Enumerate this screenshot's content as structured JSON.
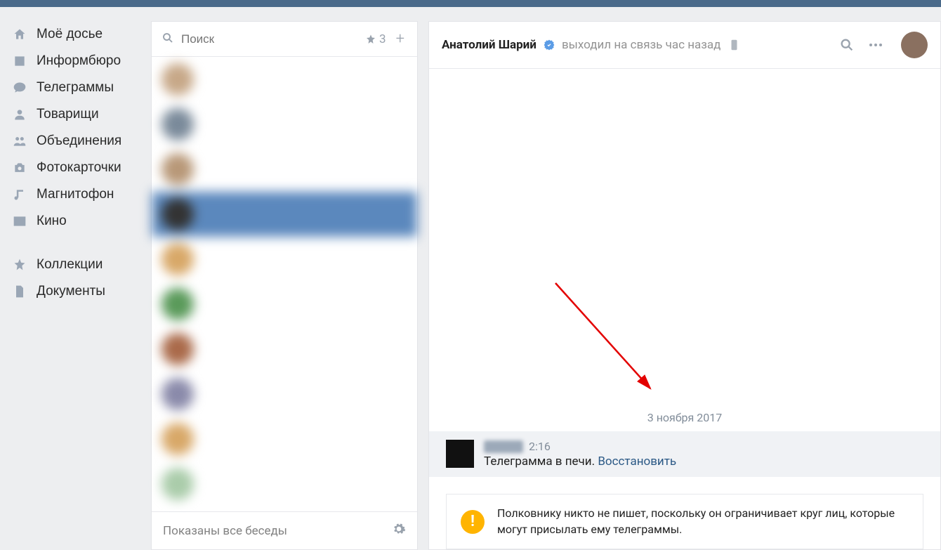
{
  "sidebar": {
    "items": [
      {
        "label": "Моё досье",
        "icon": "home-icon"
      },
      {
        "label": "Информбюро",
        "icon": "news-icon"
      },
      {
        "label": "Телеграммы",
        "icon": "messages-icon"
      },
      {
        "label": "Товарищи",
        "icon": "friends-icon"
      },
      {
        "label": "Объединения",
        "icon": "groups-icon"
      },
      {
        "label": "Фотокарточки",
        "icon": "photos-icon"
      },
      {
        "label": "Магнитофон",
        "icon": "music-icon"
      },
      {
        "label": "Кино",
        "icon": "video-icon"
      }
    ],
    "secondary": [
      {
        "label": "Коллекции",
        "icon": "star-icon"
      },
      {
        "label": "Документы",
        "icon": "document-icon"
      }
    ]
  },
  "search": {
    "placeholder": "Поиск",
    "starred_count": "3"
  },
  "convo_footer": "Показаны все беседы",
  "chat": {
    "title": "Анатолий Шарий",
    "status": "выходил на связь час назад",
    "date_label": "3 ноября 2017",
    "message": {
      "time": "2:16",
      "text": "Телеграмма в печи. ",
      "restore": "Восстановить"
    },
    "notice": "Полковнику никто не пишет, поскольку он ограничивает круг лиц, которые могут присылать ему телеграммы."
  }
}
